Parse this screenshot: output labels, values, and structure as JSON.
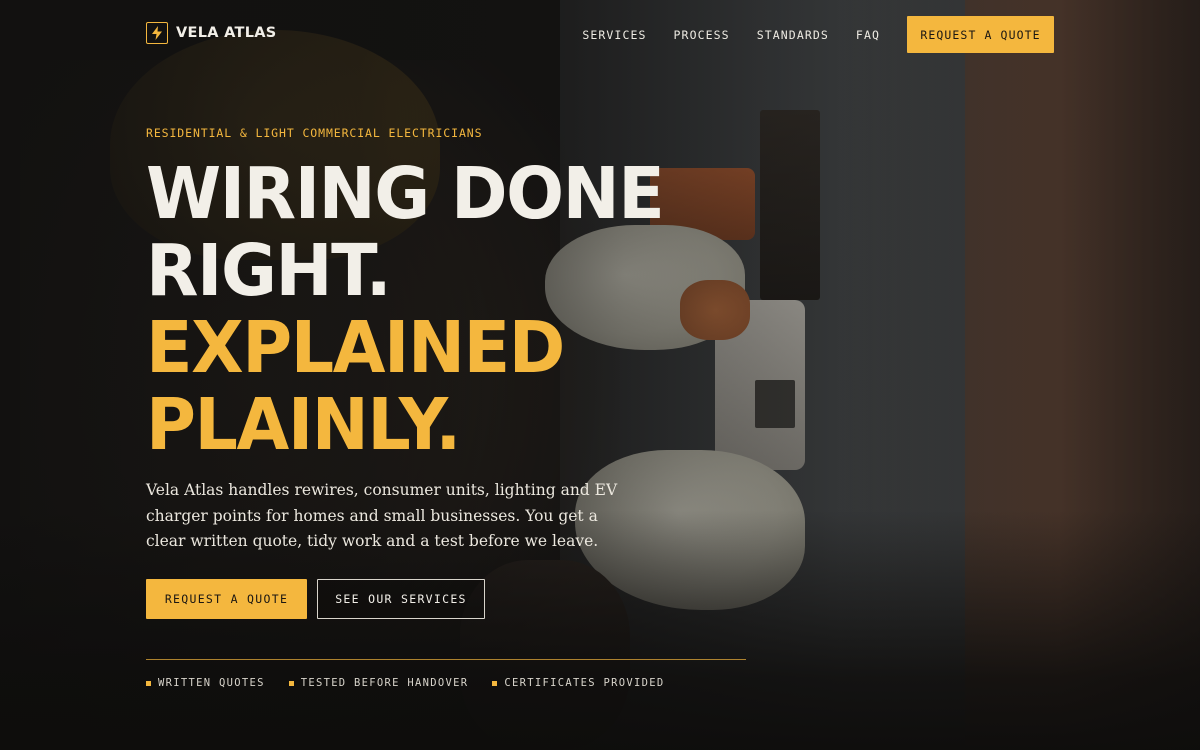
{
  "brand": {
    "name": "VELA ATLAS",
    "logo_icon": "lightning-bolt-icon"
  },
  "nav": {
    "links": [
      "SERVICES",
      "PROCESS",
      "STANDARDS",
      "FAQ"
    ],
    "cta_label": "REQUEST A QUOTE"
  },
  "hero": {
    "eyebrow": "RESIDENTIAL & LIGHT COMMERCIAL ELECTRICIANS",
    "headline_line1": "WIRING DONE",
    "headline_line2": "RIGHT.",
    "headline_line3": "EXPLAINED",
    "headline_line4": "PLAINLY.",
    "lede": "Vela Atlas handles rewires, consumer units, lighting and EV charger points for homes and small businesses. You get a clear written quote, tidy work and a test before we leave.",
    "primary_cta": "REQUEST A QUOTE",
    "secondary_cta": "SEE OUR SERVICES"
  },
  "trust": [
    "WRITTEN QUOTES",
    "TESTED BEFORE HANDOVER",
    "CERTIFICATES PROVIDED"
  ],
  "colors": {
    "accent": "#f4b73e",
    "text": "#f2efe8",
    "background": "#141312"
  }
}
